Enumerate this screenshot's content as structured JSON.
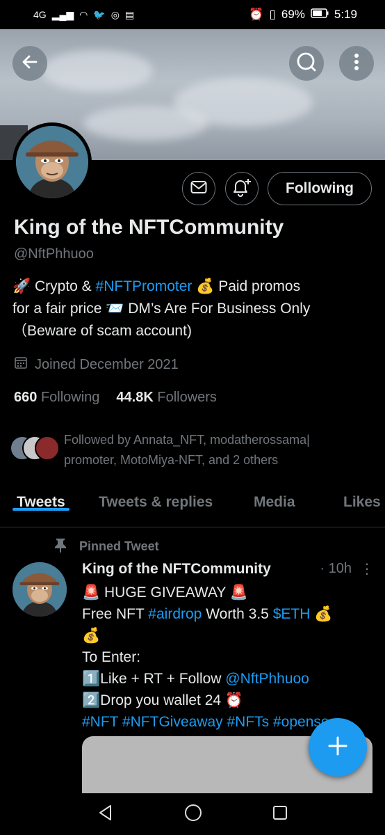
{
  "status_bar": {
    "network": "4G",
    "battery": "69%",
    "time": "5:19"
  },
  "profile": {
    "name": "King of the NFTCommunity",
    "handle": "@NftPhhuoo",
    "follow_button": "Following",
    "bio": {
      "line1_pre": "🚀 Crypto & ",
      "line1_tag": "#NFTPromoter",
      "line1_post": " 💰 Paid promos",
      "line2": "for a fair price 📨 DM’s Are For Business Only",
      "line3": "（Beware of scam account)"
    },
    "joined": "Joined December 2021",
    "following_count": "660",
    "following_label": "Following",
    "followers_count": "44.8K",
    "followers_label": "Followers",
    "followed_by_line1": "Followed by Annata_NFT, modatherossama|",
    "followed_by_line2": "promoter, MotoMiya-NFT, and 2 others"
  },
  "tabs": [
    {
      "label": "Tweets",
      "active": true
    },
    {
      "label": "Tweets & replies",
      "active": false
    },
    {
      "label": "Media",
      "active": false
    },
    {
      "label": "Likes",
      "active": false
    }
  ],
  "tweet": {
    "pinned_label": "Pinned Tweet",
    "author": "King of the NFTCommunity",
    "time": "· 10h",
    "more": "⋮",
    "line1": "🚨 HUGE GIVEAWAY 🚨",
    "line2_pre": " Free NFT ",
    "line2_tag": "#airdrop",
    "line2_mid": " Worth 3.5 ",
    "line2_cash": "$ETH",
    "line2_post": " 💰",
    "line3": "💰",
    "line4": " To Enter:",
    "line5_pre": "1️⃣Like + RT + Follow ",
    "line5_mention": "@NftPhhuoo",
    "line6": "2️⃣Drop you wallet   24 ⏰",
    "line7": "#NFT #NFTGiveaway #NFTs #opensea"
  },
  "colors": {
    "accent": "#1d9bf0",
    "background": "#000000",
    "text": "#e7e9ea",
    "muted": "#71767b"
  },
  "icons": [
    "back-arrow-icon",
    "search-icon",
    "more-vertical-icon",
    "mail-icon",
    "bell-plus-icon",
    "calendar-icon",
    "pin-icon",
    "compose-plus-icon",
    "nav-back-icon",
    "nav-home-icon",
    "nav-recents-icon"
  ]
}
